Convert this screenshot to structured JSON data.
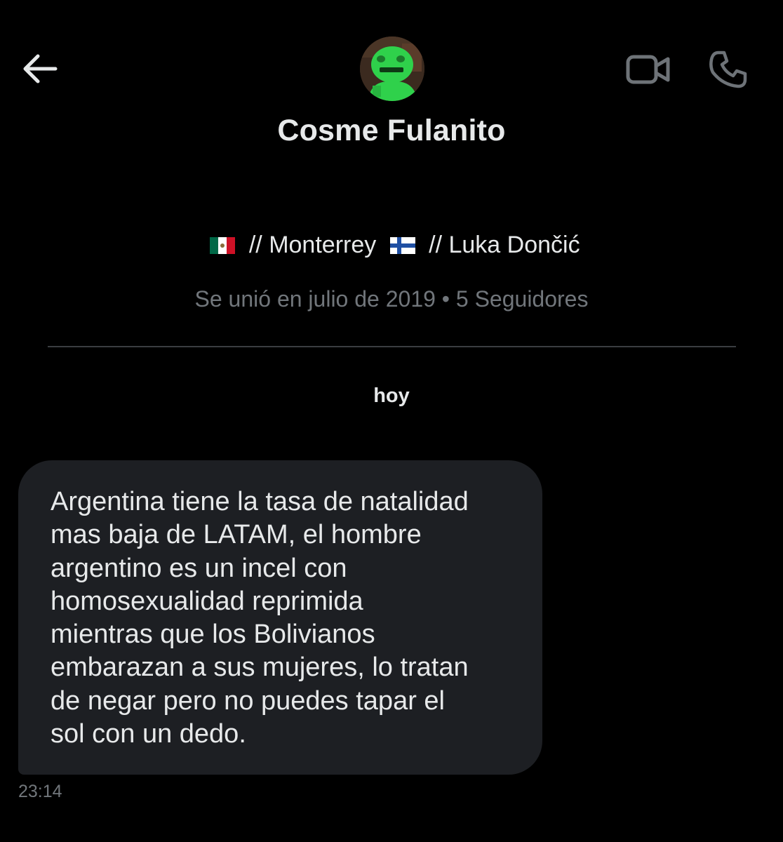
{
  "header": {
    "back_icon": "arrow-left-icon",
    "video_icon": "video-camera-icon",
    "phone_icon": "phone-icon"
  },
  "profile": {
    "display_name": "Cosme Fulanito",
    "bio_part_1": " // Monterrey ",
    "bio_part_2": " // Luka Dončić",
    "flag_1": "mexico-flag",
    "flag_2": "finland-flag",
    "meta": "Se unió en julio de 2019 • 5 Seguidores"
  },
  "conversation": {
    "date_separator": "hoy",
    "messages": [
      {
        "text": "Argentina tiene la tasa de natalidad\nmas baja de LATAM, el hombre\nargentino es un incel con\nhomosexualidad reprimida\nmientras que los Bolivianos\nembarazan a sus mujeres, lo tratan\nde negar pero no puedes tapar el\nsol con un dedo.",
        "time": "23:14"
      }
    ]
  },
  "colors": {
    "background": "#000000",
    "primary_text": "#e7e9ea",
    "secondary_text": "#71767b",
    "bubble": "#1d1f23",
    "avatar_green": "#2fd14b"
  }
}
